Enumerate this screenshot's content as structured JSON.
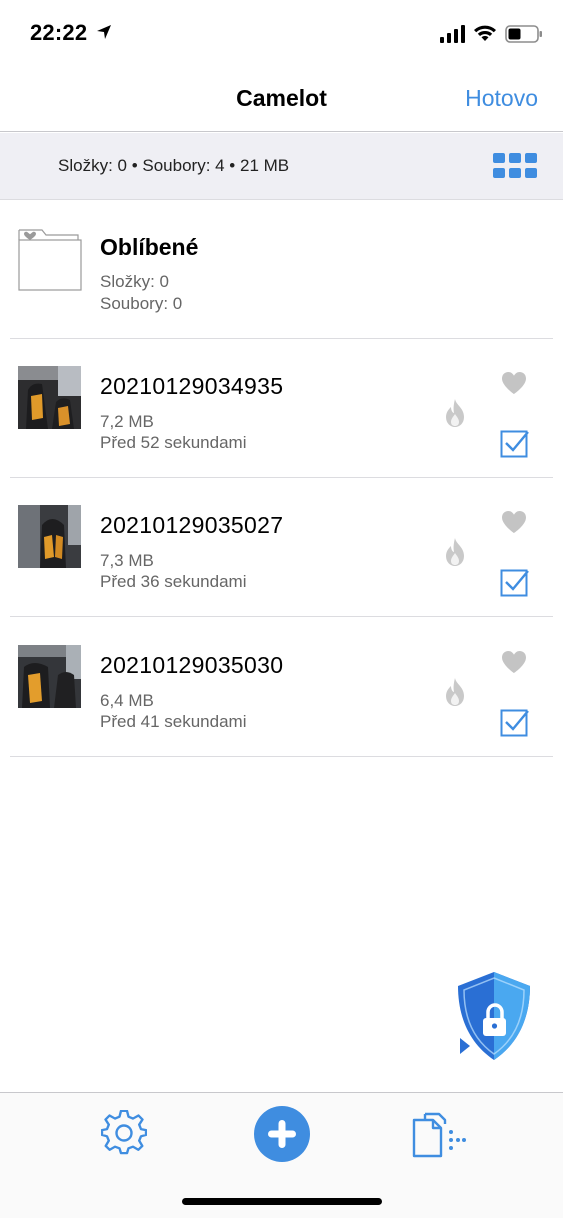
{
  "status_bar": {
    "time": "22:22"
  },
  "nav": {
    "title": "Camelot",
    "done_label": "Hotovo"
  },
  "summary": {
    "text": "Složky: 0 • Soubory: 4 • 21 MB"
  },
  "folder": {
    "title": "Oblíbené",
    "folders": "Složky: 0",
    "files": "Soubory: 0"
  },
  "items": [
    {
      "name": "20210129034935",
      "size": "7,2 MB",
      "time": "Před 52 sekundami"
    },
    {
      "name": "20210129035027",
      "size": "7,3 MB",
      "time": "Před 36 sekundami"
    },
    {
      "name": "20210129035030",
      "size": "6,4 MB",
      "time": "Před 41 sekundami"
    }
  ],
  "colors": {
    "accent": "#3f8de0",
    "secondary_text": "#666666",
    "summary_bg": "#efeff4",
    "icon_gray": "#c4c4c4"
  },
  "icons": [
    "location-arrow-icon",
    "signal-icon",
    "wifi-icon",
    "battery-icon",
    "grid-view-icon",
    "folder-heart-icon",
    "fire-icon",
    "heart-icon",
    "checkbox-checked-icon",
    "shield-lock-icon",
    "settings-gear-icon",
    "add-plus-icon",
    "files-copy-icon"
  ]
}
